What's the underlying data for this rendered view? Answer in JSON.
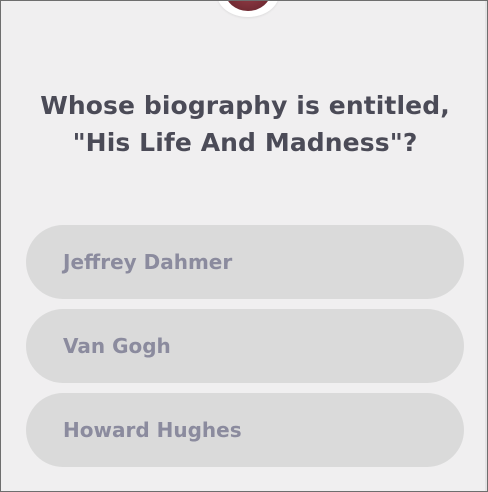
{
  "quiz": {
    "question": "Whose biography is entitled, \"His Life And Madness\"?",
    "answers": [
      {
        "label": "Jeffrey Dahmer"
      },
      {
        "label": "Van Gogh"
      },
      {
        "label": "Howard Hughes"
      }
    ]
  },
  "colors": {
    "background": "#f0eff0",
    "question_text": "#4b4b57",
    "answer_bg": "#dadada",
    "answer_text": "#8b8b9e"
  }
}
